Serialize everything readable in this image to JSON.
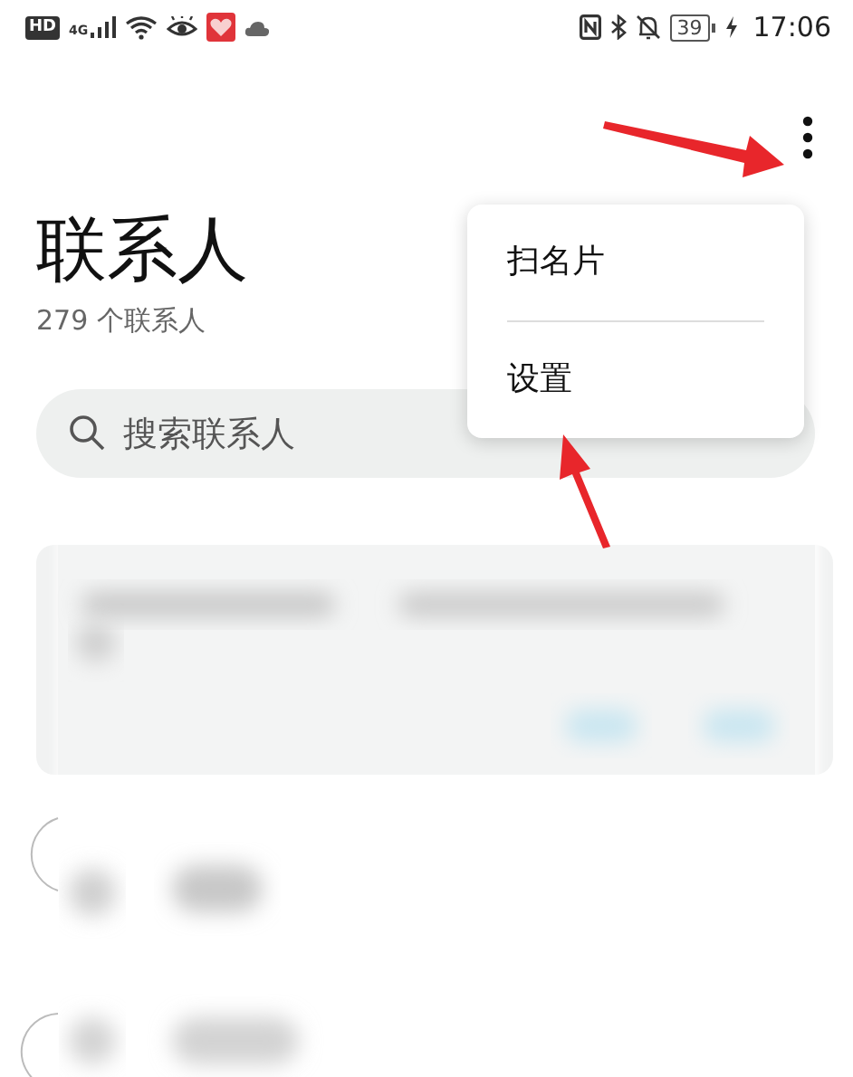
{
  "status_bar": {
    "network_badge": "HD",
    "network_type": "4G",
    "battery": "39",
    "time": "17:06"
  },
  "header": {
    "title": "联系人",
    "subtitle": "279 个联系人"
  },
  "search": {
    "placeholder": "搜索联系人"
  },
  "menu": {
    "items": [
      {
        "label": "扫名片"
      },
      {
        "label": "设置"
      }
    ]
  }
}
